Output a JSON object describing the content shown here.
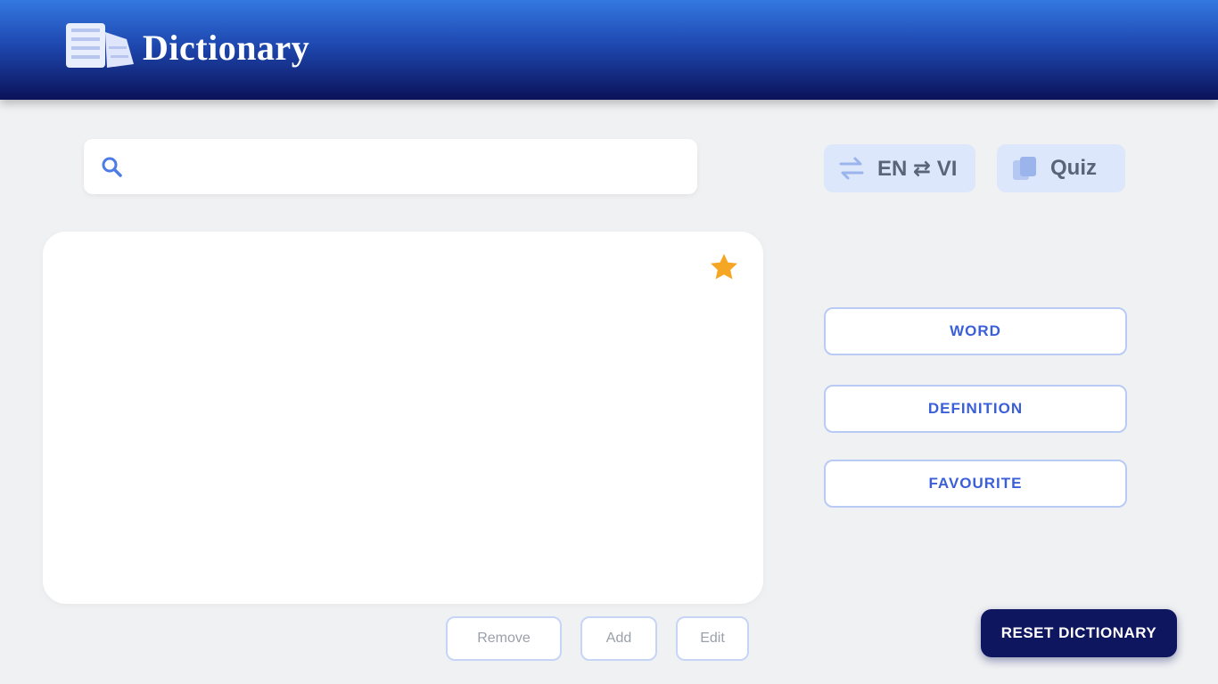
{
  "header": {
    "title": "Dictionary",
    "logo_icon": "dictionary-books-icon"
  },
  "search": {
    "value": "",
    "placeholder": "",
    "icon": "search-icon"
  },
  "toolbar": {
    "language_label": "EN ⇄ VI",
    "language_icon": "swap-icon",
    "quiz_label": "Quiz",
    "quiz_icon": "quiz-icon"
  },
  "card": {
    "favorite_icon": "star-icon",
    "content": ""
  },
  "side_buttons": [
    {
      "label": "WORD"
    },
    {
      "label": "DEFINITION"
    },
    {
      "label": "FAVOURITE"
    }
  ],
  "actions": {
    "remove_label": "Remove",
    "add_label": "Add",
    "edit_label": "Edit"
  },
  "reset": {
    "label": "RESET DICTIONARY"
  },
  "colors": {
    "header_top": "#3378e0",
    "header_bottom": "#0b1259",
    "accent": "#3b5fd8",
    "star": "#f5a623",
    "reset_bg": "#0f1660"
  }
}
